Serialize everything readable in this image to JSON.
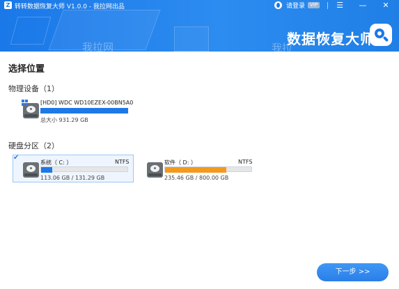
{
  "app": {
    "icon_letter": "Z",
    "title": "转转数据恢复大师 V1.0.0 - 我拉网出品",
    "login_label": "请登录",
    "vip_badge": "VIP",
    "brand": "数据恢复大师",
    "watermark_left": "我拉网",
    "watermark_right": "我拉",
    "controls": {
      "menu": "☰",
      "minimize": "—",
      "close": "✕"
    }
  },
  "page": {
    "title": "选择位置"
  },
  "physical_devices": {
    "header": "物理设备（1）",
    "items": [
      {
        "name": "[HD0] WDC WD10EZEX-00BN5A0",
        "size_text": "总大小 931.29 GB",
        "usage": 1.0,
        "icon": "hard-disk-icon"
      }
    ]
  },
  "partitions": {
    "header": "硬盘分区（2）",
    "items": [
      {
        "name": "系统（ C: ）",
        "fs": "NTFS",
        "size_text": "113.06 GB / 131.29 GB",
        "usage": 0.13,
        "bar_color": "#1e78e6",
        "selected": true,
        "icon": "hard-disk-icon"
      },
      {
        "name": "软件（ D: ）",
        "fs": "NTFS",
        "size_text": "235.46 GB / 800.00 GB",
        "usage": 0.71,
        "bar_color": "#f39a1e",
        "selected": false,
        "icon": "hard-disk-icon"
      }
    ]
  },
  "footer": {
    "next_label": "下一步 >>"
  }
}
